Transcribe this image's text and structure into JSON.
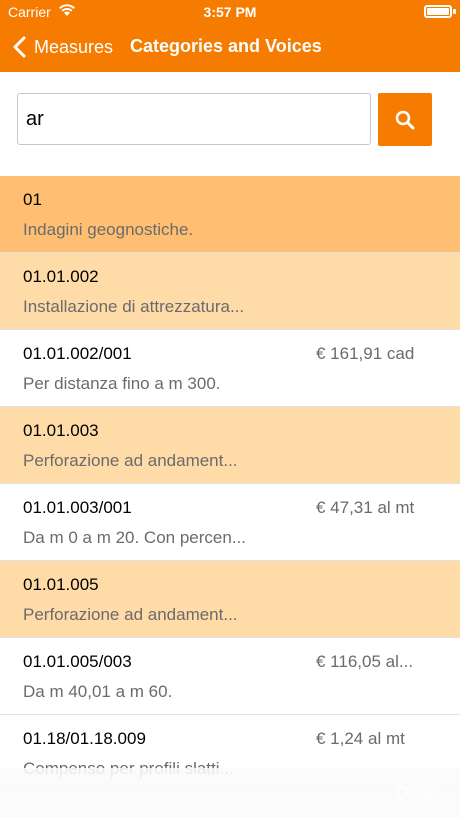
{
  "status_bar": {
    "carrier": "Carrier",
    "time": "3:57 PM"
  },
  "nav": {
    "back_label": "Measures",
    "title": "Categories and Voices"
  },
  "search": {
    "value": "ar",
    "placeholder": ""
  },
  "items": [
    {
      "code": "01",
      "description": "Indagini geognostiche.",
      "price": "",
      "level": "category"
    },
    {
      "code": "01.01.002",
      "description": "Installazione di attrezzatura...",
      "price": "",
      "level": "subcategory"
    },
    {
      "code": "01.01.002/001",
      "description": "Per distanza fino a m 300.",
      "price": "€  161,91 cad",
      "level": "voice"
    },
    {
      "code": "01.01.003",
      "description": "Perforazione ad andament...",
      "price": "",
      "level": "subcategory"
    },
    {
      "code": "01.01.003/001",
      "description": "Da m 0 a m 20. Con percen...",
      "price": "€  47,31 al mt",
      "level": "voice"
    },
    {
      "code": "01.01.005",
      "description": "Perforazione ad andament...",
      "price": "",
      "level": "subcategory"
    },
    {
      "code": "01.01.005/003",
      "description": "Da m 40,01 a m 60.",
      "price": "€  116,05 al...",
      "level": "voice"
    },
    {
      "code": "01.18/01.18.009",
      "description": "Compenso per profili slatti...",
      "price": "€  1,24 al mt",
      "level": "voice"
    }
  ],
  "toolbar": {
    "done_label": "Done"
  },
  "colors": {
    "accent": "#f57c00",
    "category_bg": "#ffbf73",
    "subcategory_bg": "#ffdba8"
  }
}
